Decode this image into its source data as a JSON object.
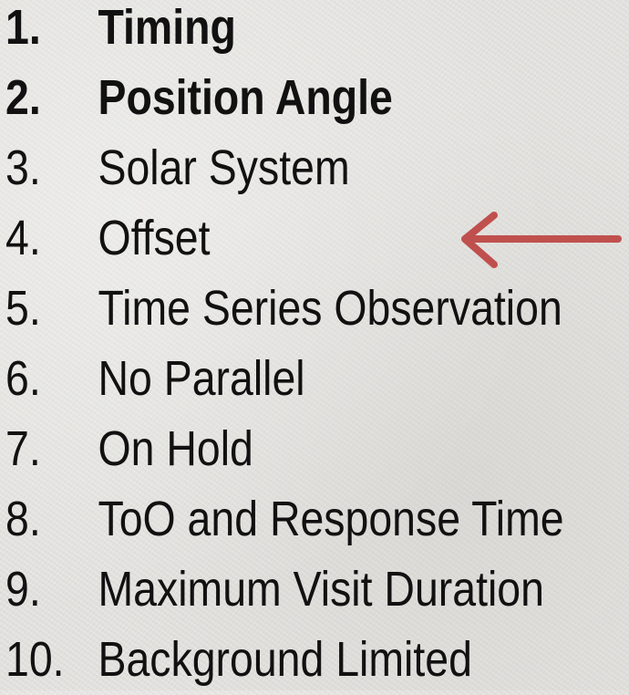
{
  "items": [
    {
      "number": "1.",
      "text": "Timing",
      "bold": true
    },
    {
      "number": "2.",
      "text": "Position Angle",
      "bold": true
    },
    {
      "number": "3.",
      "text": "Solar System",
      "bold": false
    },
    {
      "number": "4.",
      "text": "Offset",
      "bold": false
    },
    {
      "number": "5.",
      "text": "Time Series Observation",
      "bold": false
    },
    {
      "number": "6.",
      "text": "No Parallel",
      "bold": false
    },
    {
      "number": "7.",
      "text": "On Hold",
      "bold": false
    },
    {
      "number": "8.",
      "text": "ToO and Response Time",
      "bold": false
    },
    {
      "number": "9.",
      "text": "Maximum Visit Duration",
      "bold": false
    },
    {
      "number": "10.",
      "text": "Background Limited",
      "bold": false
    }
  ],
  "arrow": {
    "points_to": "4",
    "icon": "left-arrow-icon",
    "color": "#c0504d"
  }
}
